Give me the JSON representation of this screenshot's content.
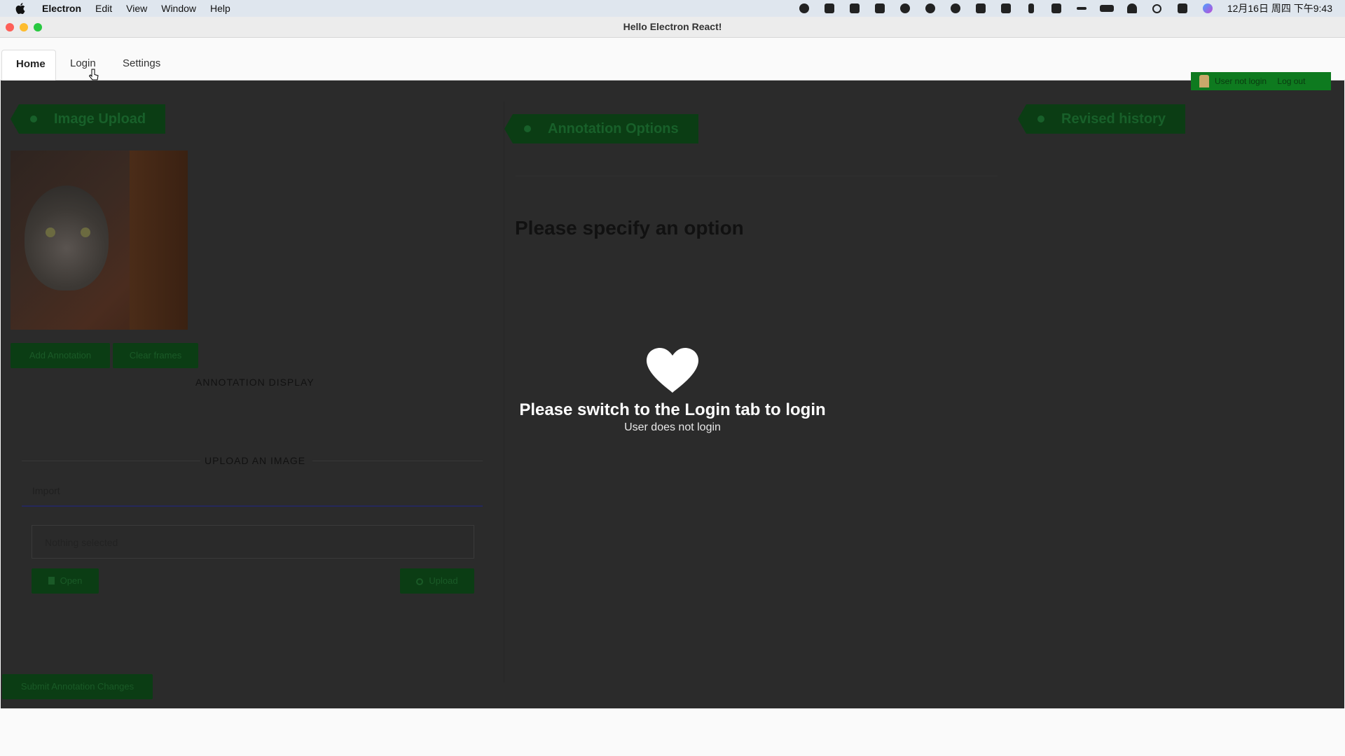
{
  "menubar": {
    "items": [
      "Electron",
      "Edit",
      "View",
      "Window",
      "Help"
    ],
    "clock": "12月16日 周四 下午9:43"
  },
  "window": {
    "title": "Hello Electron React!"
  },
  "tabs": [
    {
      "label": "Home",
      "active": true
    },
    {
      "label": "Login",
      "active": false
    },
    {
      "label": "Settings",
      "active": false
    }
  ],
  "left_panel": {
    "ribbon": "Image Upload",
    "add_annotation": "Add Annotation",
    "clear_frames": "Clear frames",
    "annotation_display": "ANNOTATION DISPLAY",
    "upload_heading": "UPLOAD AN IMAGE",
    "import_label": "Import",
    "file_placeholder": "Nothing selected",
    "open_button": "Open",
    "upload_button": "Upload",
    "submit_button": "Submit Annotation Changes"
  },
  "middle_panel": {
    "ribbon": "Annotation Options",
    "prompt": "Please specify an option"
  },
  "right_panel": {
    "ribbon": "Revised history"
  },
  "user_badge": {
    "status": "User not login",
    "logout": "Log out"
  },
  "overlay": {
    "title": "Please switch to the Login tab to login",
    "subtitle": "User does not login"
  },
  "colors": {
    "dim_background": "#2b2b2b",
    "green_dark": "#0b3d14",
    "green_badge": "#0e7a1f"
  }
}
